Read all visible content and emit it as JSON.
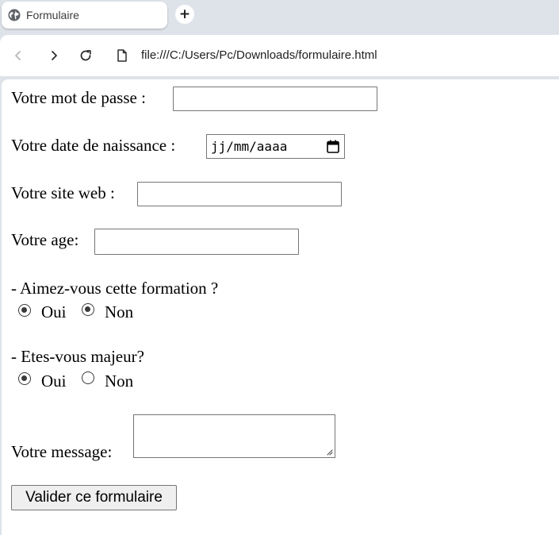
{
  "browser": {
    "tab_title": "Formulaire",
    "new_tab_symbol": "+",
    "url": "file:///C:/Users/Pc/Downloads/formulaire.html",
    "icons": {
      "favicon": "globe-icon",
      "new_tab": "plus-icon",
      "back": "arrow-left-icon",
      "forward": "arrow-right-icon",
      "reload": "reload-icon",
      "page_info": "file-icon"
    }
  },
  "form": {
    "password_label": "Votre mot de passe :",
    "birthdate_label": "Votre date de naissance :",
    "birthdate_placeholder": "jj/mm/aaaa",
    "website_label": "Votre site web :",
    "age_label": "Votre age:",
    "question1": "- Aimez-vous cette formation ?",
    "q1_oui": "Oui",
    "q1_non": "Non",
    "q1_oui_checked": true,
    "q1_non_checked": true,
    "question2": "- Etes-vous majeur?",
    "q2_oui": "Oui",
    "q2_non": "Non",
    "q2_oui_checked": true,
    "q2_non_checked": false,
    "message_label": "Votre message:",
    "submit_label": "Valider ce formulaire"
  }
}
